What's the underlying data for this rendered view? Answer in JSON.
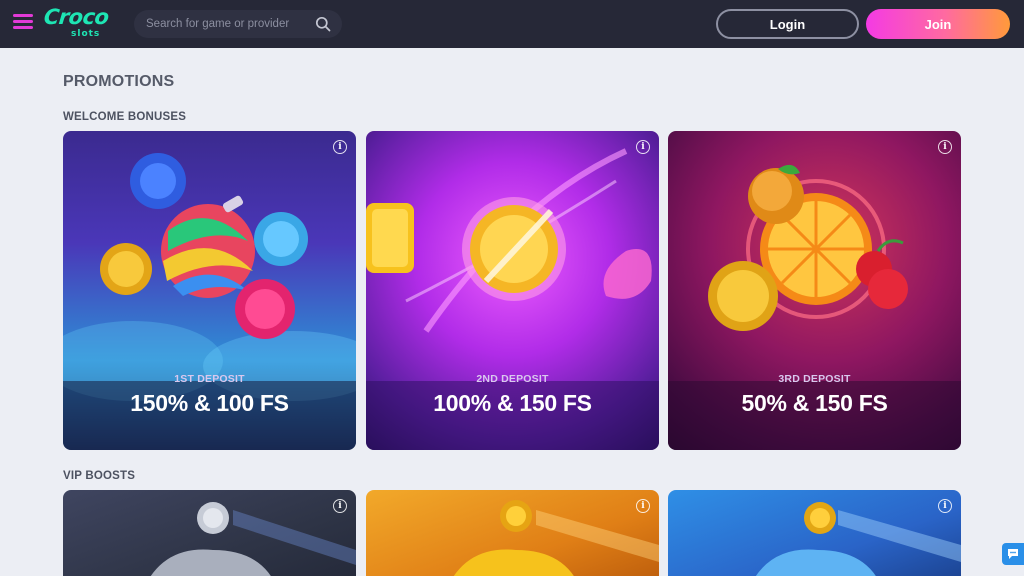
{
  "header": {
    "menu_icon": "hamburger-menu-icon",
    "logo_text": "Croco",
    "logo_sub": "slots",
    "search_placeholder": "Search for game or provider",
    "search_icon": "search-icon",
    "login_label": "Login",
    "join_label": "Join",
    "colors": {
      "bg": "#262837",
      "accent": "#e23ad7",
      "logo": "#1ee6b4"
    }
  },
  "page": {
    "title": "PROMOTIONS"
  },
  "welcome": {
    "title": "WELCOME BONUSES",
    "cards": [
      {
        "label": "1ST DEPOSIT",
        "value": "150% & 100 FS"
      },
      {
        "label": "2ND DEPOSIT",
        "value": "100% & 150 FS"
      },
      {
        "label": "3RD DEPOSIT",
        "value": "50% & 150 FS"
      }
    ]
  },
  "vip": {
    "title": "VIP BOOSTS",
    "cards": [
      {
        "theme": "silver"
      },
      {
        "theme": "gold"
      },
      {
        "theme": "blue"
      }
    ]
  },
  "icons": {
    "info": "info-icon",
    "chat": "chat-icon"
  }
}
